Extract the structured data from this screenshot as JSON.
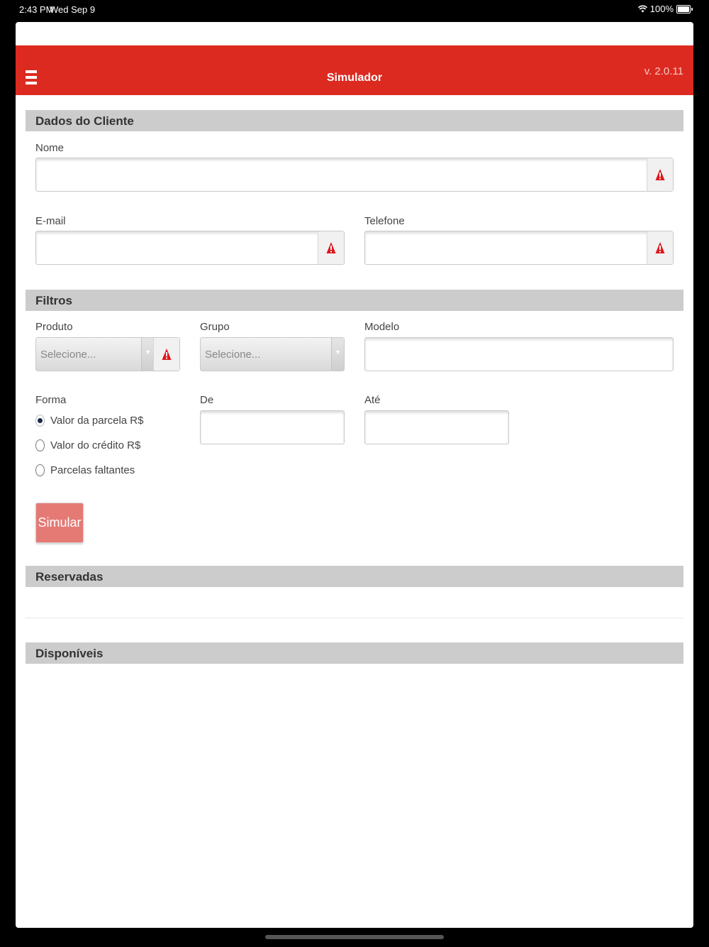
{
  "status_bar": {
    "time": "2:43 PM",
    "date": "Wed Sep 9",
    "battery": "100%"
  },
  "header": {
    "title": "Simulador",
    "version": "v. 2.0.11"
  },
  "sections": {
    "cliente": "Dados do Cliente",
    "filtros": "Filtros",
    "reservadas": "Reservadas",
    "disponiveis": "Disponíveis"
  },
  "cliente": {
    "nome_label": "Nome",
    "nome_value": "",
    "email_label": "E-mail",
    "email_value": "",
    "telefone_label": "Telefone",
    "telefone_value": ""
  },
  "filtros": {
    "produto_label": "Produto",
    "produto_selected": "Selecione...",
    "grupo_label": "Grupo",
    "grupo_selected": "Selecione...",
    "modelo_label": "Modelo",
    "modelo_value": "",
    "forma_label": "Forma",
    "forma_options": [
      "Valor da parcela R$",
      "Valor do crédito R$",
      "Parcelas faltantes"
    ],
    "forma_selected": 0,
    "de_label": "De",
    "de_value": "",
    "ate_label": "Até",
    "ate_value": ""
  },
  "actions": {
    "simular": "Simular"
  },
  "icons": {
    "menu": "hamburger-menu-icon",
    "warning": "warning-triangle-icon",
    "dropdown": "chevron-down-icon",
    "wifi": "wifi-icon",
    "battery": "battery-icon"
  },
  "colors": {
    "brand": "#dc2a20",
    "button": "#e57a75",
    "section_bg": "#cccccc",
    "warning": "#e0161c"
  }
}
